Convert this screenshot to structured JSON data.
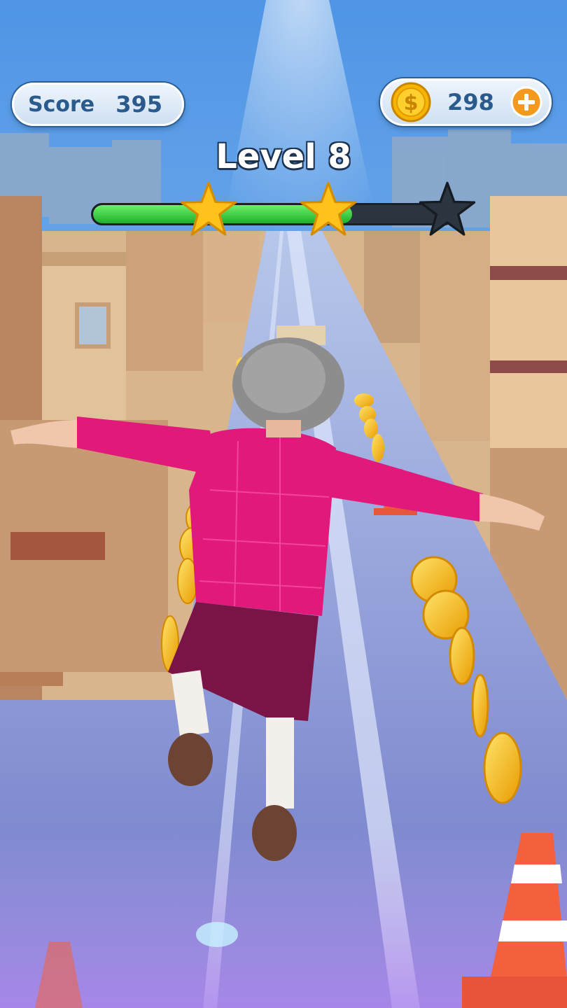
{
  "hud": {
    "score_label": "Score",
    "score_value": "395",
    "coins_value": "298",
    "level_title": "Level 8"
  },
  "progress": {
    "fraction": 0.72,
    "stars": [
      {
        "earned": true,
        "icon": "star-filled-icon"
      },
      {
        "earned": true,
        "icon": "star-filled-icon"
      },
      {
        "earned": false,
        "icon": "star-empty-icon"
      }
    ]
  },
  "icons": {
    "coin": "dollar-coin-icon",
    "add": "plus-icon"
  },
  "colors": {
    "hud_text": "#2b5a8c",
    "progress_fill": "#2fc23a",
    "star_gold": "#ffc21a",
    "star_empty": "#2a3540",
    "add_button": "#f39a1e",
    "jacket": "#e0197a",
    "skirt": "#7a1446"
  }
}
